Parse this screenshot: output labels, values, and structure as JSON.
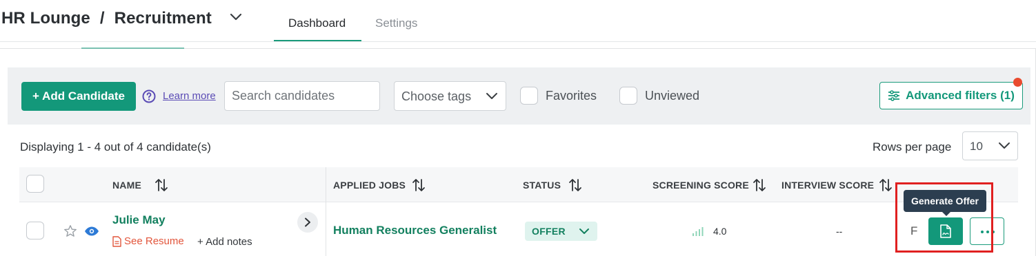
{
  "header": {
    "workspace": "HR Lounge",
    "separator": "/",
    "section": "Recruitment",
    "tabs": [
      {
        "label": "Dashboard",
        "active": true
      },
      {
        "label": "Settings",
        "active": false
      }
    ]
  },
  "toolbar": {
    "add_candidate_label": "+ Add Candidate",
    "learn_more_label": "Learn more",
    "search_placeholder": "Search candidates",
    "tags_placeholder": "Choose tags",
    "favorites_label": "Favorites",
    "unviewed_label": "Unviewed",
    "advanced_filters_label": "Advanced filters (1)"
  },
  "summary": {
    "display_text": "Displaying 1 - 4 out of 4 candidate(s)",
    "rows_per_page_label": "Rows per page",
    "rows_per_page_value": "10"
  },
  "table": {
    "columns": {
      "name": "NAME",
      "applied_jobs": "APPLIED JOBS",
      "status": "STATUS",
      "screening_score": "SCREENING SCORE",
      "interview_score": "INTERVIEW SCORE"
    },
    "rows": [
      {
        "name": "Julie May",
        "see_resume": "See Resume",
        "add_notes": "+ Add notes",
        "applied_job": "Human Resources Generalist",
        "status": "OFFER",
        "screening_score": "4.0",
        "interview_score": "--",
        "clipped_text": "F"
      }
    ]
  },
  "tooltip": {
    "text": "Generate Offer"
  },
  "colors": {
    "brand": "#13987a",
    "link_purple": "#5a4bb5",
    "resume_red": "#e2553b",
    "notification": "#e94b2f",
    "tooltip_bg": "#2c3e50",
    "highlight": "#e02020"
  }
}
